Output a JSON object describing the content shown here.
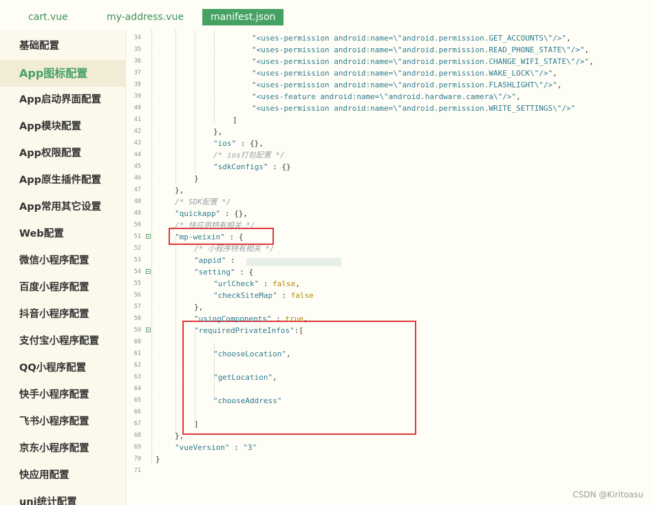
{
  "tabs": [
    {
      "label": "cart.vue",
      "active": false
    },
    {
      "label": "my-address.vue",
      "active": false
    },
    {
      "label": "manifest.json",
      "active": true
    }
  ],
  "sidebar": {
    "active_index": 1,
    "items": [
      "基础配置",
      "App图标配置",
      "App启动界面配置",
      "App模块配置",
      "App权限配置",
      "App原生插件配置",
      "App常用其它设置",
      "Web配置",
      "微信小程序配置",
      "百度小程序配置",
      "抖音小程序配置",
      "支付宝小程序配置",
      "QQ小程序配置",
      "快手小程序配置",
      "飞书小程序配置",
      "京东小程序配置",
      "快应用配置",
      "uni统计配置"
    ]
  },
  "colors": {
    "accent": "#45a263",
    "string": "#2c7a8f",
    "comment": "#9aa0a6",
    "keyword": "#b8860b",
    "plain": "#333333",
    "highlight_box": "#e0333c"
  },
  "editor": {
    "lines": [
      {
        "n": "34",
        "indent": 5,
        "tokens": [
          {
            "t": "\"<uses-permission android:name=\\\"android.permission.GET_ACCOUNTS\\\"/>\"",
            "c": "string"
          },
          {
            "t": ",",
            "c": "plain"
          }
        ]
      },
      {
        "n": "35",
        "indent": 5,
        "tokens": [
          {
            "t": "\"<uses-permission android:name=\\\"android.permission.READ_PHONE_STATE\\\"/>\"",
            "c": "string"
          },
          {
            "t": ",",
            "c": "plain"
          }
        ]
      },
      {
        "n": "36",
        "indent": 5,
        "tokens": [
          {
            "t": "\"<uses-permission android:name=\\\"android.permission.CHANGE_WIFI_STATE\\\"/>\"",
            "c": "string"
          },
          {
            "t": ",",
            "c": "plain"
          }
        ]
      },
      {
        "n": "37",
        "indent": 5,
        "tokens": [
          {
            "t": "\"<uses-permission android:name=\\\"android.permission.WAKE_LOCK\\\"/>\"",
            "c": "string"
          },
          {
            "t": ",",
            "c": "plain"
          }
        ]
      },
      {
        "n": "38",
        "indent": 5,
        "tokens": [
          {
            "t": "\"<uses-permission android:name=\\\"android.permission.FLASHLIGHT\\\"/>\"",
            "c": "string"
          },
          {
            "t": ",",
            "c": "plain"
          }
        ]
      },
      {
        "n": "39",
        "indent": 5,
        "tokens": [
          {
            "t": "\"<uses-feature android:name=\\\"android.hardware.camera\\\"/>\"",
            "c": "string"
          },
          {
            "t": ",",
            "c": "plain"
          }
        ]
      },
      {
        "n": "40",
        "indent": 5,
        "tokens": [
          {
            "t": "\"<uses-permission android:name=\\\"android.permission.WRITE_SETTINGS\\\"/>\"",
            "c": "string"
          }
        ]
      },
      {
        "n": "41",
        "indent": 4,
        "tokens": [
          {
            "t": "]",
            "c": "plain"
          }
        ]
      },
      {
        "n": "42",
        "indent": 3,
        "tokens": [
          {
            "t": "},",
            "c": "plain"
          }
        ]
      },
      {
        "n": "43",
        "indent": 3,
        "tokens": [
          {
            "t": "\"ios\"",
            "c": "string"
          },
          {
            "t": " : {},",
            "c": "plain"
          }
        ]
      },
      {
        "n": "44",
        "indent": 3,
        "tokens": [
          {
            "t": "/* ios打包配置 */",
            "c": "comment"
          }
        ]
      },
      {
        "n": "45",
        "indent": 3,
        "tokens": [
          {
            "t": "\"sdkConfigs\"",
            "c": "string"
          },
          {
            "t": " : {}",
            "c": "plain"
          }
        ]
      },
      {
        "n": "46",
        "indent": 2,
        "tokens": [
          {
            "t": "}",
            "c": "plain"
          }
        ]
      },
      {
        "n": "47",
        "indent": 1,
        "tokens": [
          {
            "t": "},",
            "c": "plain"
          }
        ]
      },
      {
        "n": "48",
        "indent": 1,
        "tokens": [
          {
            "t": "/* SDK配置 */",
            "c": "comment"
          }
        ]
      },
      {
        "n": "49",
        "indent": 1,
        "tokens": [
          {
            "t": "\"quickapp\"",
            "c": "string"
          },
          {
            "t": " : {},",
            "c": "plain"
          }
        ]
      },
      {
        "n": "50",
        "indent": 1,
        "tokens": [
          {
            "t": "/* 快应用特有相关 */",
            "c": "comment"
          }
        ]
      },
      {
        "n": "51",
        "indent": 1,
        "fold": true,
        "tokens": [
          {
            "t": "\"mp-weixin\"",
            "c": "string"
          },
          {
            "t": " : {",
            "c": "plain"
          }
        ]
      },
      {
        "n": "52",
        "indent": 2,
        "tokens": [
          {
            "t": "/* 小程序特有相关 */",
            "c": "comment"
          }
        ]
      },
      {
        "n": "53",
        "indent": 2,
        "tokens": [
          {
            "t": "\"appid\"",
            "c": "string"
          },
          {
            "t": " : ",
            "c": "plain"
          }
        ]
      },
      {
        "n": "54",
        "indent": 2,
        "fold": true,
        "tokens": [
          {
            "t": "\"setting\"",
            "c": "string"
          },
          {
            "t": " : {",
            "c": "plain"
          }
        ]
      },
      {
        "n": "55",
        "indent": 3,
        "tokens": [
          {
            "t": "\"urlCheck\"",
            "c": "string"
          },
          {
            "t": " : ",
            "c": "plain"
          },
          {
            "t": "false",
            "c": "keyword"
          },
          {
            "t": ",",
            "c": "plain"
          }
        ]
      },
      {
        "n": "56",
        "indent": 3,
        "tokens": [
          {
            "t": "\"checkSiteMap\"",
            "c": "string"
          },
          {
            "t": " : ",
            "c": "plain"
          },
          {
            "t": "false",
            "c": "keyword"
          }
        ]
      },
      {
        "n": "57",
        "indent": 2,
        "tokens": [
          {
            "t": "},",
            "c": "plain"
          }
        ]
      },
      {
        "n": "58",
        "indent": 2,
        "tokens": [
          {
            "t": "\"usingComponents\"",
            "c": "string"
          },
          {
            "t": " : ",
            "c": "plain"
          },
          {
            "t": "true",
            "c": "keyword"
          },
          {
            "t": ",",
            "c": "plain"
          }
        ]
      },
      {
        "n": "59",
        "indent": 2,
        "fold": true,
        "tokens": [
          {
            "t": "\"requiredPrivateInfos\"",
            "c": "string"
          },
          {
            "t": ":[",
            "c": "plain"
          }
        ]
      },
      {
        "n": "60",
        "indent": 3,
        "tokens": []
      },
      {
        "n": "61",
        "indent": 3,
        "tokens": [
          {
            "t": "\"chooseLocation\"",
            "c": "string"
          },
          {
            "t": ",",
            "c": "plain"
          }
        ]
      },
      {
        "n": "62",
        "indent": 3,
        "tokens": []
      },
      {
        "n": "63",
        "indent": 3,
        "tokens": [
          {
            "t": "\"getLocation\"",
            "c": "string"
          },
          {
            "t": ",",
            "c": "plain"
          }
        ]
      },
      {
        "n": "64",
        "indent": 3,
        "tokens": []
      },
      {
        "n": "65",
        "indent": 3,
        "tokens": [
          {
            "t": "\"chooseAddress\"",
            "c": "string"
          }
        ]
      },
      {
        "n": "66",
        "indent": 3,
        "tokens": []
      },
      {
        "n": "67",
        "indent": 2,
        "tokens": [
          {
            "t": "]",
            "c": "plain"
          }
        ]
      },
      {
        "n": "68",
        "indent": 1,
        "tokens": [
          {
            "t": "},",
            "c": "plain"
          }
        ]
      },
      {
        "n": "69",
        "indent": 1,
        "tokens": [
          {
            "t": "\"vueVersion\"",
            "c": "string"
          },
          {
            "t": " : ",
            "c": "plain"
          },
          {
            "t": "\"3\"",
            "c": "string"
          }
        ]
      },
      {
        "n": "70",
        "indent": 0,
        "tokens": [
          {
            "t": "}",
            "c": "plain"
          }
        ]
      },
      {
        "n": "71",
        "indent": 0,
        "tokens": []
      }
    ]
  },
  "watermark": "CSDN @Kiritoasu"
}
